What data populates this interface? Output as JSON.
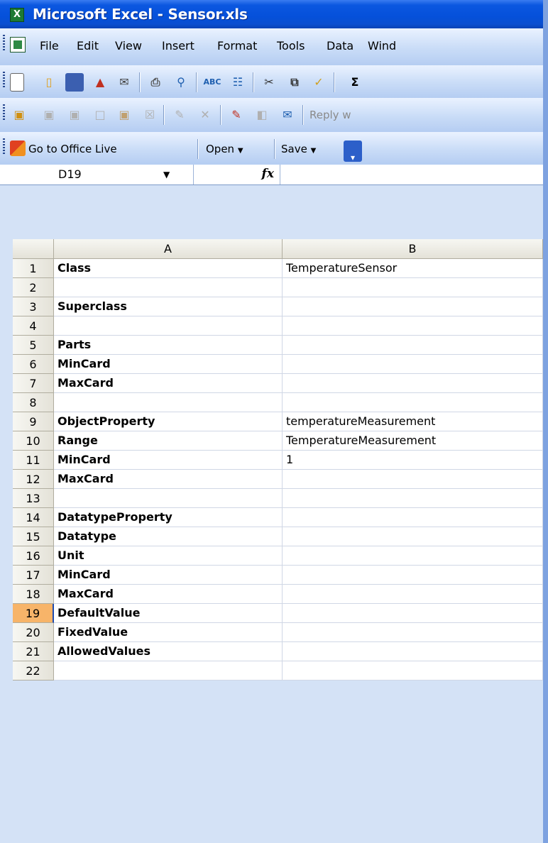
{
  "window": {
    "title": "Microsoft Excel - Sensor.xls"
  },
  "menu": [
    "File",
    "Edit",
    "View",
    "Insert",
    "Format",
    "Tools",
    "Data",
    "Wind"
  ],
  "toolbar": {
    "reply_label": "Reply w",
    "office_live_label": "Go to Office Live",
    "open_label": "Open",
    "save_label": "Save",
    "sum_glyph": "Σ"
  },
  "formula_bar": {
    "name_box": "D19",
    "fx_label": "fx",
    "content": ""
  },
  "grid": {
    "columns": [
      "A",
      "B"
    ],
    "selected_row": "19",
    "rows": [
      {
        "num": "1",
        "a": "Class",
        "b": "TemperatureSensor"
      },
      {
        "num": "2",
        "a": "",
        "b": ""
      },
      {
        "num": "3",
        "a": "Superclass",
        "b": ""
      },
      {
        "num": "4",
        "a": "",
        "b": ""
      },
      {
        "num": "5",
        "a": "Parts",
        "b": ""
      },
      {
        "num": "6",
        "a": "MinCard",
        "b": ""
      },
      {
        "num": "7",
        "a": "MaxCard",
        "b": ""
      },
      {
        "num": "8",
        "a": "",
        "b": ""
      },
      {
        "num": "9",
        "a": "ObjectProperty",
        "b": "temperatureMeasurement"
      },
      {
        "num": "10",
        "a": "Range",
        "b": "TemperatureMeasurement"
      },
      {
        "num": "11",
        "a": "MinCard",
        "b": "1"
      },
      {
        "num": "12",
        "a": "MaxCard",
        "b": ""
      },
      {
        "num": "13",
        "a": "",
        "b": ""
      },
      {
        "num": "14",
        "a": "DatatypeProperty",
        "b": ""
      },
      {
        "num": "15",
        "a": "Datatype",
        "b": ""
      },
      {
        "num": "16",
        "a": "Unit",
        "b": ""
      },
      {
        "num": "17",
        "a": "MinCard",
        "b": ""
      },
      {
        "num": "18",
        "a": "MaxCard",
        "b": ""
      },
      {
        "num": "19",
        "a": "DefaultValue",
        "b": ""
      },
      {
        "num": "20",
        "a": "FixedValue",
        "b": ""
      },
      {
        "num": "21",
        "a": "AllowedValues",
        "b": ""
      },
      {
        "num": "22",
        "a": "",
        "b": ""
      }
    ]
  }
}
